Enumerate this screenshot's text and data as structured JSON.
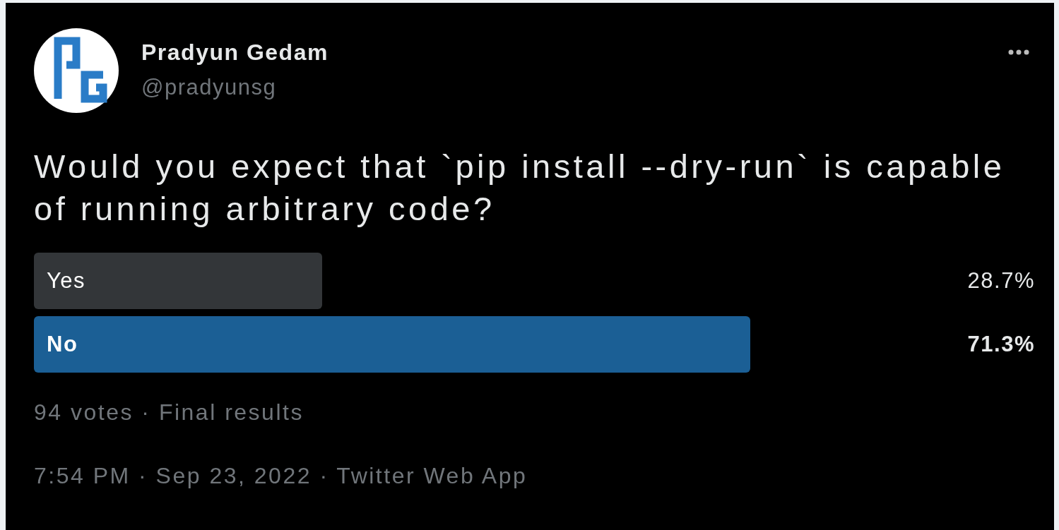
{
  "author": {
    "name": "Pradyun Gedam",
    "handle": "@pradyunsg"
  },
  "text": "Would you expect that `pip install --dry-run` is capable of running arbitrary code?",
  "poll": {
    "options": [
      {
        "label": "Yes",
        "percent": "28.7%",
        "leading": false
      },
      {
        "label": "No",
        "percent": "71.3%",
        "leading": true
      }
    ],
    "summary": "94 votes · Final results"
  },
  "meta": "7:54 PM · Sep 23, 2022 · Twitter Web App"
}
